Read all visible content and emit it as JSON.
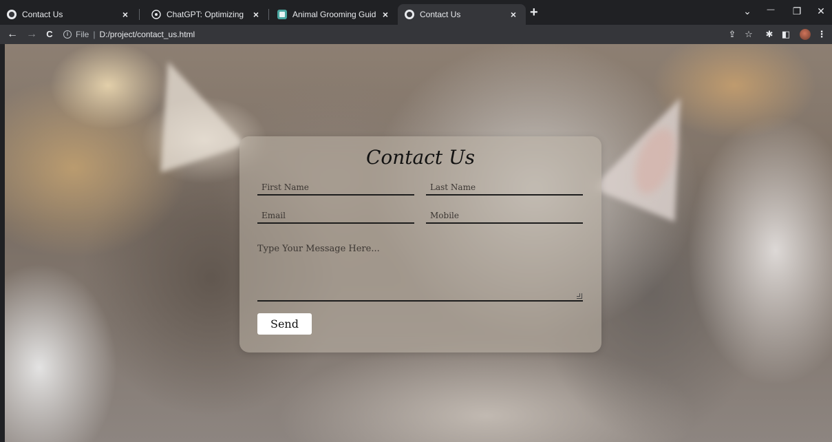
{
  "browser": {
    "tabs": [
      {
        "title": "Contact Us",
        "icon": "globe-icon",
        "active": false
      },
      {
        "title": "ChatGPT: Optimizing Language M",
        "icon": "chatgpt-icon",
        "active": false
      },
      {
        "title": "Animal Grooming Guide",
        "icon": "book-icon",
        "active": false
      },
      {
        "title": "Contact Us",
        "icon": "globe-icon",
        "active": true
      }
    ],
    "close_glyph": "×",
    "new_tab_glyph": "+",
    "window_controls": {
      "tab_search": "⌄",
      "minimize": "—",
      "restore": "❐",
      "close": "✕"
    },
    "nav": {
      "back": "←",
      "forward": "→",
      "reload": "C"
    },
    "address": {
      "info_glyph": "i",
      "scheme_label": "File",
      "separator": "|",
      "url": "D:/project/contact_us.html"
    },
    "toolbar_icons": {
      "share": "⇪",
      "bookmark": "☆",
      "extensions": "✱",
      "side_panel": "◧",
      "menu": "⋮"
    }
  },
  "page": {
    "form": {
      "title": "Contact Us",
      "first_name_placeholder": "First Name",
      "last_name_placeholder": "Last Name",
      "email_placeholder": "Email",
      "mobile_placeholder": "Mobile",
      "message_placeholder": "Type Your Message Here...",
      "send_label": "Send"
    }
  }
}
